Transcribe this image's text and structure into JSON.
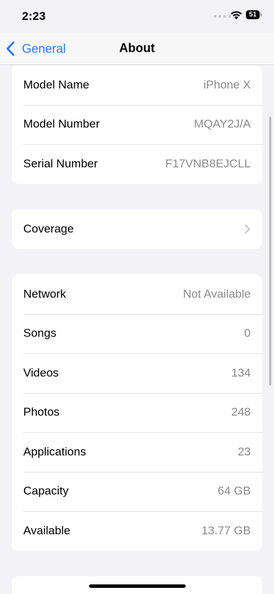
{
  "status": {
    "time": "2:23",
    "battery": "51"
  },
  "nav": {
    "back_label": "General",
    "title": "About"
  },
  "group1": {
    "rows": [
      {
        "label": "Model Name",
        "value": "iPhone X"
      },
      {
        "label": "Model Number",
        "value": "MQAY2J/A"
      },
      {
        "label": "Serial Number",
        "value": "F17VNB8EJCLL"
      }
    ]
  },
  "group2": {
    "rows": [
      {
        "label": "Coverage"
      }
    ]
  },
  "group3": {
    "rows": [
      {
        "label": "Network",
        "value": "Not Available"
      },
      {
        "label": "Songs",
        "value": "0"
      },
      {
        "label": "Videos",
        "value": "134"
      },
      {
        "label": "Photos",
        "value": "248"
      },
      {
        "label": "Applications",
        "value": "23"
      },
      {
        "label": "Capacity",
        "value": "64 GB"
      },
      {
        "label": "Available",
        "value": "13.77 GB"
      }
    ]
  },
  "colors": {
    "accent": "#2f7bf5",
    "background": "#f2f2f7",
    "secondary_text": "#8a8a8e"
  }
}
